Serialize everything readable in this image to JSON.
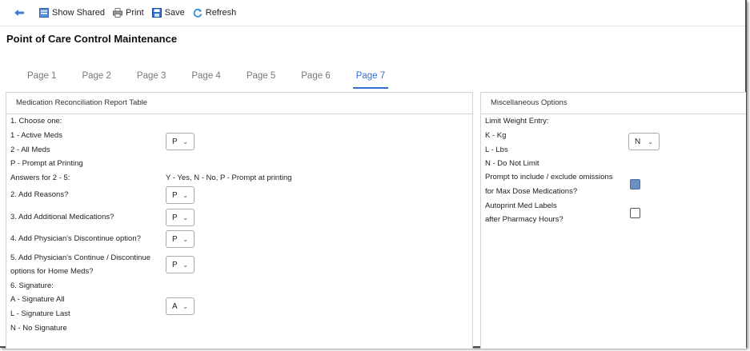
{
  "toolbar": {
    "show_shared": "Show Shared",
    "print": "Print",
    "save": "Save",
    "refresh": "Refresh"
  },
  "page_title": "Point of Care Control Maintenance",
  "tabs": [
    {
      "label": "Page 1",
      "active": false
    },
    {
      "label": "Page 2",
      "active": false
    },
    {
      "label": "Page 3",
      "active": false
    },
    {
      "label": "Page 4",
      "active": false
    },
    {
      "label": "Page 5",
      "active": false
    },
    {
      "label": "Page 6",
      "active": false
    },
    {
      "label": "Page 7",
      "active": true
    }
  ],
  "left_panel": {
    "title": "Medication Reconciliation Report Table",
    "choose_one": "1. Choose one:",
    "opt_active": "1 - Active Meds",
    "opt_all": "2 - All Meds",
    "opt_prompt": "P - Prompt at Printing",
    "answers_label": "Answers for 2 - 5:",
    "answers_legend": "Y - Yes, N - No, P - Prompt at printing",
    "q2": "2. Add Reasons?",
    "q3": "3. Add Additional Medications?",
    "q4": "4. Add Physician's Discontinue option?",
    "q5_line1": "5. Add Physician's Continue / Discontinue",
    "q5_line2": "options for Home Meds?",
    "q6": "6. Signature:",
    "sig_all": "A - Signature All",
    "sig_last": "L - Signature Last",
    "sig_none": "N - No Signature",
    "sel1": "P",
    "sel2": "P",
    "sel3": "P",
    "sel4": "P",
    "sel5": "P",
    "sel6": "A"
  },
  "right_panel": {
    "title": "Miscellaneous Options",
    "limit_weight": "Limit Weight Entry:",
    "opt_kg": "K - Kg",
    "opt_lbs": "L - Lbs",
    "opt_none": "N - Do Not Limit",
    "limit_value": "N",
    "prompt_line1": "Prompt to include / exclude omissions",
    "prompt_line2": "for Max Dose Medications?",
    "prompt_checked": true,
    "autoprint_line1": "Autoprint Med Labels",
    "autoprint_line2": "after Pharmacy Hours?",
    "autoprint_checked": false
  },
  "colors": {
    "accent": "#2f6fd0",
    "checkbox_on": "#6e8fc4"
  }
}
